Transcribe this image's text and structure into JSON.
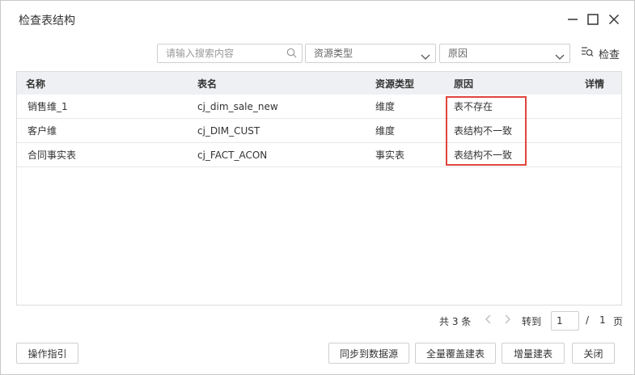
{
  "dialog": {
    "title": "检查表结构"
  },
  "toolbar": {
    "search_placeholder": "请输入搜索内容",
    "type_select": "资源类型",
    "reason_select": "原因",
    "check_label": "检查"
  },
  "grid": {
    "columns": {
      "name": "名称",
      "table": "表名",
      "type": "资源类型",
      "reason": "原因",
      "detail": "详情"
    },
    "rows": [
      {
        "name": "销售维_1",
        "table": "cj_dim_sale_new",
        "type": "维度",
        "reason": "表不存在"
      },
      {
        "name": "客户维",
        "table": "cj_DIM_CUST",
        "type": "维度",
        "reason": "表结构不一致"
      },
      {
        "name": "合同事实表",
        "table": "cj_FACT_ACON",
        "type": "事实表",
        "reason": "表结构不一致"
      }
    ]
  },
  "pager": {
    "total": "共 3 条",
    "goto": "转到",
    "current_page": "1",
    "separator": "/",
    "pages": "1",
    "unit": "页"
  },
  "footer": {
    "guide": "操作指引",
    "sync": "同步到数据源",
    "full_rebuild": "全量覆盖建表",
    "incremental": "增量建表",
    "close": "关闭"
  },
  "colors": {
    "highlight": "#e0453c",
    "header_bg": "#eef0f3"
  }
}
